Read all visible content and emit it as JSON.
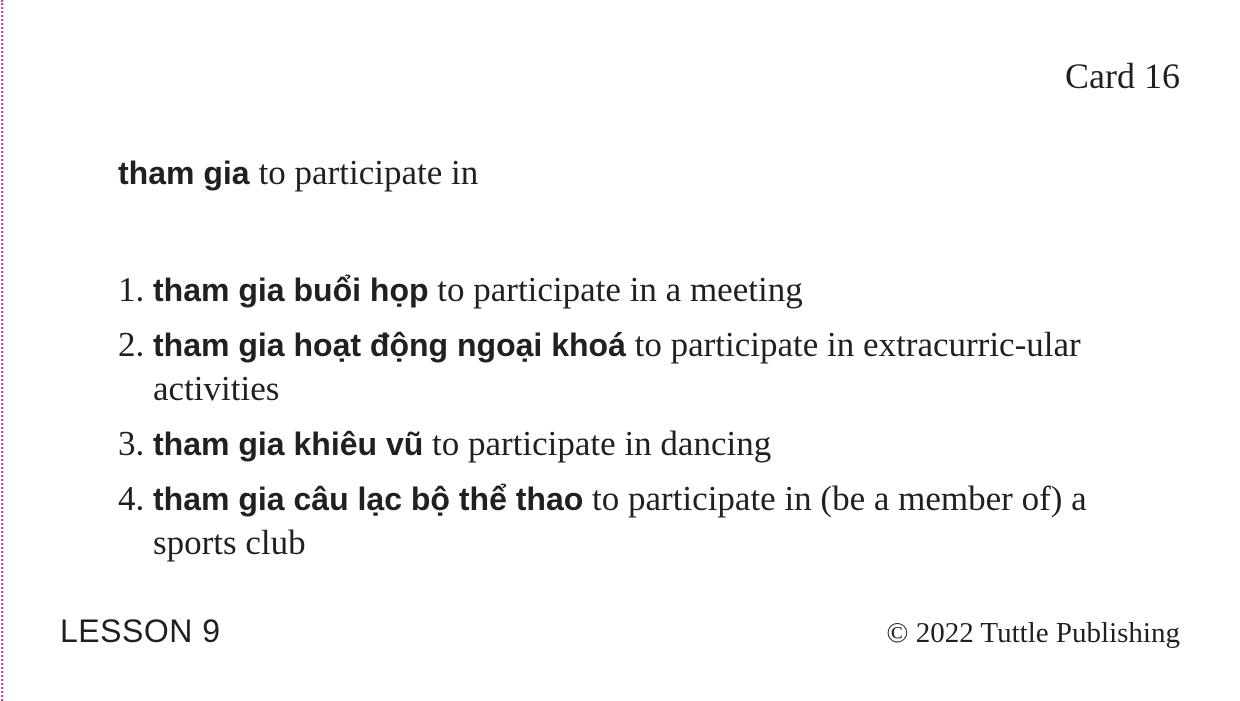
{
  "card": {
    "label": "Card 16"
  },
  "headword": {
    "vietnamese": "tham gia",
    "english": "to participate in"
  },
  "examples": [
    {
      "number": "1.",
      "vietnamese": "tham gia buổi họp",
      "english": "to participate in a meeting"
    },
    {
      "number": "2.",
      "vietnamese": "tham gia hoạt động ngoại khoá",
      "english": "to participate in extracurric-ular activities"
    },
    {
      "number": "3.",
      "vietnamese": "tham gia khiêu vũ",
      "english": "to participate in dancing"
    },
    {
      "number": "4.",
      "vietnamese": "tham gia câu lạc bộ thể thao",
      "english": "to participate in (be a member of) a sports club"
    }
  ],
  "footer": {
    "lesson": "LESSON 9",
    "copyright": "© 2022 Tuttle Publishing"
  },
  "colors": {
    "text": "#231f20",
    "cut_line": "#d63aa8",
    "background": "#ffffff"
  }
}
